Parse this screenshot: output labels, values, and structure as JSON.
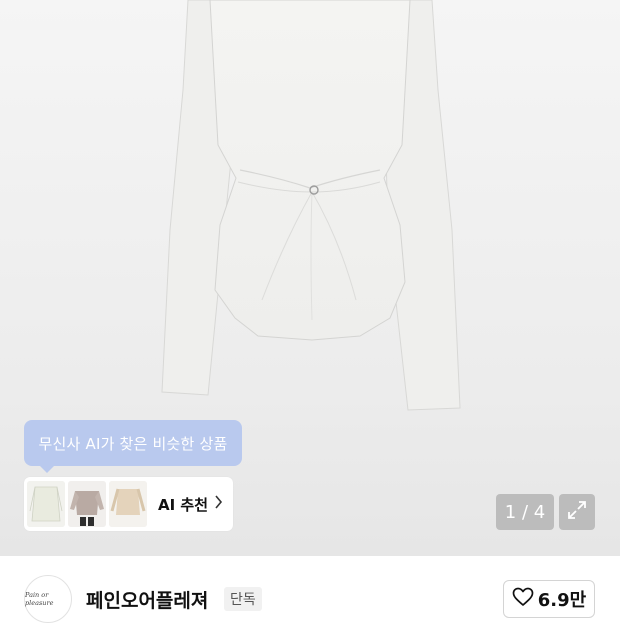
{
  "gallery": {
    "ai_tooltip": "무신사 AI가 찾은 비슷한 상품",
    "ai_recommend_label": "AI 추천",
    "counter": "1 / 4",
    "thumbnails": [
      "thumbnail-cream-top",
      "thumbnail-taupe-top",
      "thumbnail-beige-top"
    ]
  },
  "brand": {
    "name": "페인오어플레져",
    "badge": "단독",
    "logo_text": "Pain or pleasure"
  },
  "like": {
    "count": "6.9만"
  },
  "colors": {
    "tooltip_bg": "#b9c9ee",
    "product": "#f4f3f1",
    "overlay": "#aaaaaa"
  }
}
